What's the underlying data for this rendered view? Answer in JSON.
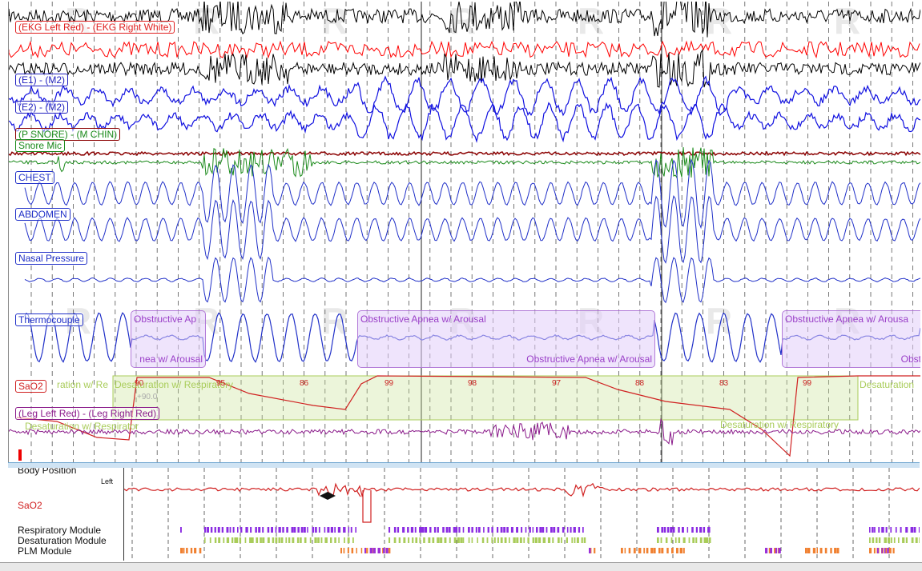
{
  "channels": {
    "ekg": "(EKG Left Red) - (EKG Right White)",
    "e1": "(E1) - (M2)",
    "e2": "(E2) - (M2)",
    "snore": "(P SNORE) - (M CHIN)",
    "snore_mic": "Snore Mic",
    "chest": "CHEST",
    "abdomen": "ABDOMEN",
    "nasal": "Nasal Pressure",
    "thermo": "Thermocouple",
    "sao2": "SaO2",
    "leg": "(Leg Left Red) - (Leg Right Red)"
  },
  "events": {
    "apnea_1_top": "Obstructive Ap",
    "apnea_1_bottom": "nea w/ Arousal",
    "apnea_2_top": "Obstructive Apnea w/ Arousal",
    "apnea_2_bottom": "Obstructive Apnea w/ Arousal",
    "apnea_3_top": "Obstructive Apnea w/ Arousa",
    "apnea_3_bottom": "Obstr",
    "desat_1": "ration w/ Re",
    "desat_2": "Desaturation w/ Respiratory",
    "desat_3": "Desaturation w/ Respiratory",
    "desat_4": "Desaturation",
    "desat_5": "Desaturation w/ Respirator"
  },
  "sao2_values": [
    "90",
    "95",
    "86",
    "99",
    "98",
    "97",
    "88",
    "83",
    "99"
  ],
  "sao2_ref": "+90.0",
  "overview": {
    "body_position": "Body Position",
    "left": "Left",
    "sao2": "SaO2",
    "respiratory": "Respiratory Module",
    "desaturation": "Desaturation Module",
    "plm": "PLM Module"
  },
  "colors": {
    "eeg_black": "#000000",
    "ekg_red": "#ff0000",
    "eog_blue": "#1010e0",
    "snore_green": "#1a8a1a",
    "chin_darkred": "#8b0000",
    "resp_blue": "#2030c8",
    "sao2_red": "#d02020",
    "leg_purple": "#8a1a8a",
    "event_purple": "#9a3fc8",
    "desat_green": "#a9cc5a"
  }
}
